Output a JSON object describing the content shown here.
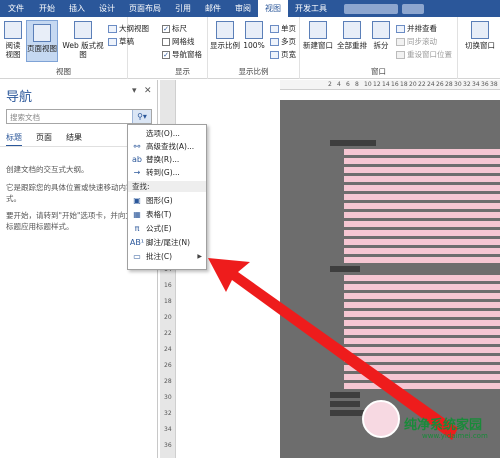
{
  "ribbon_tabs": {
    "file": "文件",
    "items": [
      "开始",
      "插入",
      "设计",
      "页面布局",
      "引用",
      "邮件",
      "审阅",
      "视图",
      "开发工具"
    ]
  },
  "ribbon": {
    "views_group": {
      "label": "视图",
      "read_mode": "阅读\n视图",
      "print_layout": "页面视图",
      "web_layout": "Web 版式视图",
      "outline": "大纲视图",
      "draft": "草稿"
    },
    "show_group": {
      "label": "显示",
      "ruler": "标尺",
      "gridlines": "网格线",
      "nav_pane": "导航窗格"
    },
    "zoom_group": {
      "label": "显示比例",
      "zoom": "显示比例",
      "hundred": "100%",
      "one_page": "单页",
      "multi_page": "多页",
      "page_width": "页宽"
    },
    "window_group": {
      "label": "窗口",
      "new_window": "新建窗口",
      "arrange_all": "全部重排",
      "split": "拆分",
      "side_by_side": "并排查看",
      "sync_scroll": "同步滚动",
      "reset_position": "重设窗口位置",
      "switch_window": "切换窗口"
    }
  },
  "nav_pane": {
    "title": "导航",
    "search_placeholder": "搜索文档",
    "tabs": [
      "标题",
      "页面",
      "结果"
    ],
    "text1": "创建文档的交互式大纲。",
    "text2": "它是跟踪您的具体位置或快速移动内容的",
    "text2b": "式。",
    "text3": "要开始，请转到\"开始\"选项卡，并向文",
    "text3b": "标题应用标题样式。"
  },
  "search_menu": {
    "options": "选项(O)...",
    "advanced_find": "高级查找(A)...",
    "replace": "替换(R)...",
    "goto": "转到(G)...",
    "find_header": "查找:",
    "graphics": "图形(G)",
    "tables": "表格(T)",
    "equations": "公式(E)",
    "footnotes": "脚注/尾注(N)",
    "comments": "批注(C)"
  },
  "ruler_marks": [
    "2",
    "4",
    "6",
    "8",
    "10",
    "12",
    "14",
    "16",
    "18",
    "20",
    "22",
    "24",
    "26",
    "28",
    "30",
    "32",
    "34",
    "36",
    "38"
  ],
  "watermark": {
    "text": "纯净系统家园",
    "url": "www.yidaimei.com"
  }
}
